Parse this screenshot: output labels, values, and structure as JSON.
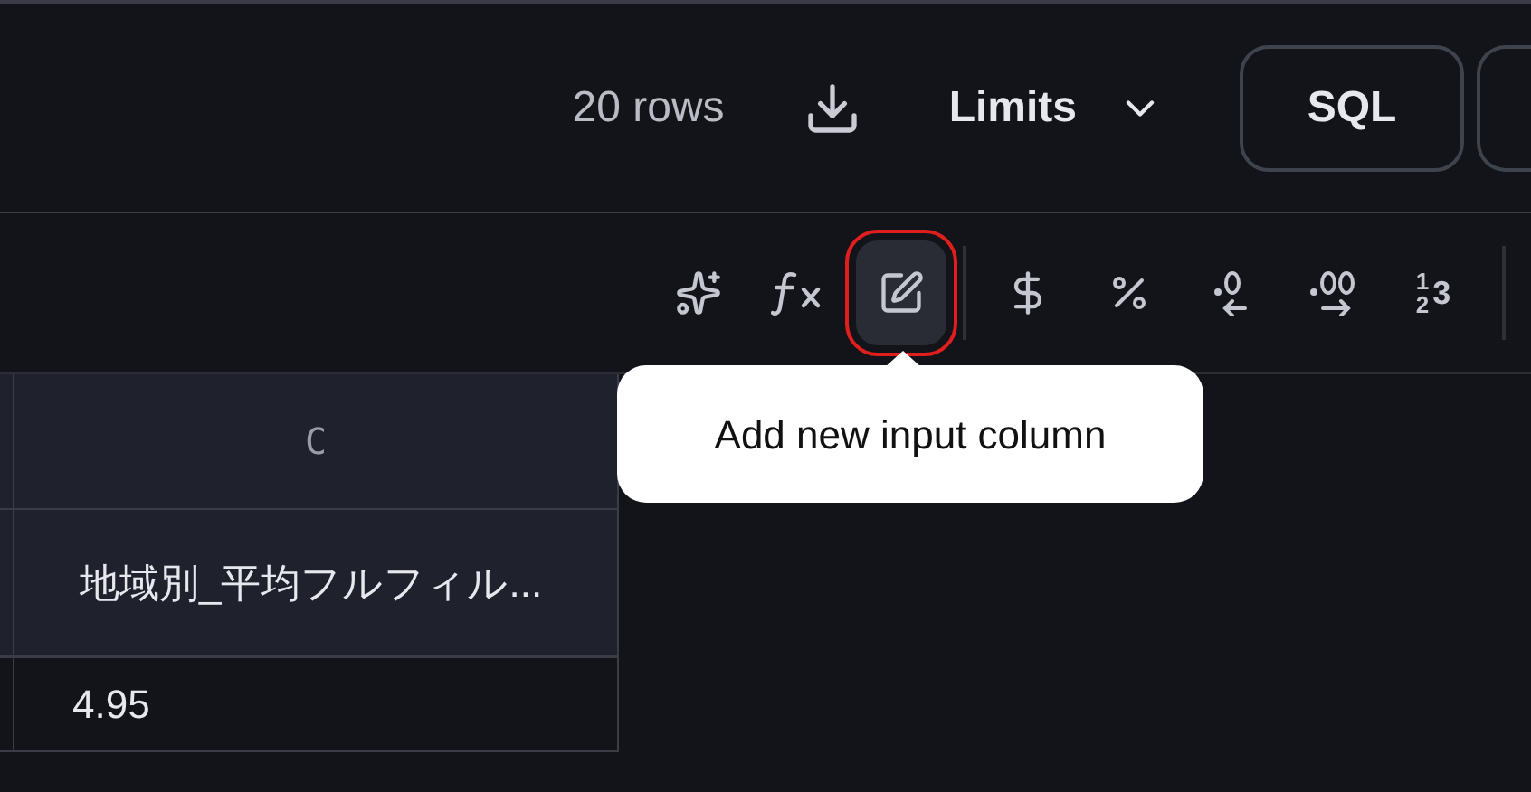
{
  "top_bar": {
    "row_count": "20 rows",
    "limits_label": "Limits",
    "sql_button": "SQL"
  },
  "toolbar": {
    "buttons": [
      {
        "selected": false
      },
      {
        "selected": false
      },
      {
        "selected": true
      },
      {
        "selected": false
      },
      {
        "selected": false
      },
      {
        "selected": false
      },
      {
        "selected": false
      },
      {
        "selected": false,
        "glyph": [
          "1",
          "2",
          "3"
        ]
      }
    ]
  },
  "tooltip": {
    "text": "Add new input column"
  },
  "table": {
    "column_letter": "C",
    "column_name": "地域別_平均フルフィル...",
    "rows": [
      "4.95"
    ]
  }
}
